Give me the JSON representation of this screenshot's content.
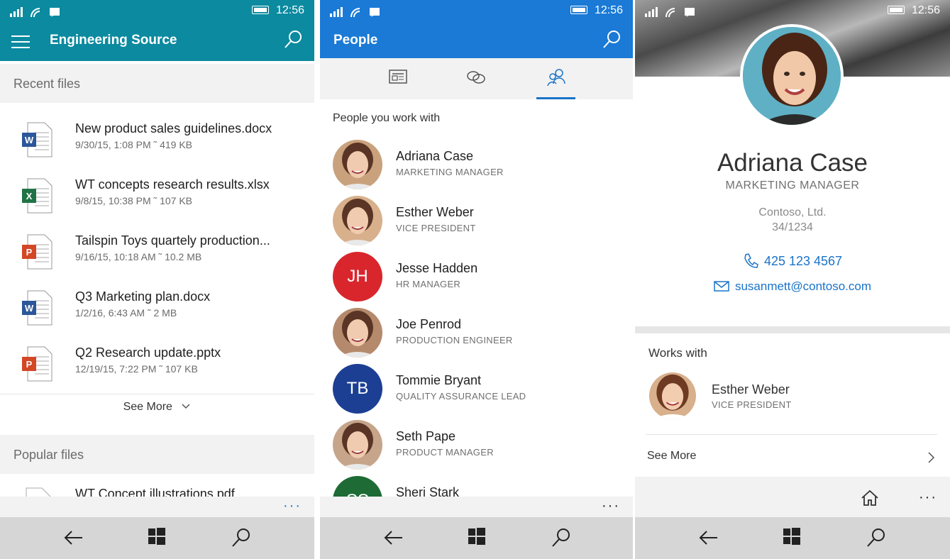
{
  "colors": {
    "teal": "#0b8aa0",
    "blue": "#1a7ad6",
    "word": "#2b579a",
    "excel": "#217346",
    "ppt": "#d24726",
    "jh": "#d9262d",
    "tb": "#1c3f94",
    "ss": "#1e6b35"
  },
  "status": {
    "time": "12:56"
  },
  "left": {
    "title": "Engineering Source",
    "recent_header": "Recent files",
    "files": [
      {
        "icon": "word-doc-icon",
        "type": "word",
        "name": "New product sales guidelines.docx",
        "meta": "9/30/15, 1:08 PM ˜ 419 KB"
      },
      {
        "icon": "excel-doc-icon",
        "type": "excel",
        "name": "WT concepts research results.xlsx",
        "meta": "9/8/15, 10:38 PM ˜ 107 KB"
      },
      {
        "icon": "powerpoint-doc-icon",
        "type": "ppt",
        "name": "Tailspin Toys quartely production...",
        "meta": "9/16/15, 10:18 AM ˜ 10.2 MB"
      },
      {
        "icon": "word-doc-icon",
        "type": "word",
        "name": "Q3 Marketing plan.docx",
        "meta": "1/2/16, 6:43 AM ˜ 2 MB"
      },
      {
        "icon": "powerpoint-doc-icon",
        "type": "ppt",
        "name": "Q2 Research update.pptx",
        "meta": "12/19/15, 7:22 PM ˜ 107 KB"
      }
    ],
    "see_more": "See More",
    "popular_header": "Popular files",
    "popular_files": [
      {
        "icon": "pdf-doc-icon",
        "name": "WT Concept illustrations.pdf"
      }
    ]
  },
  "middle": {
    "title": "People",
    "tabs": [
      {
        "icon": "news-feed-icon"
      },
      {
        "icon": "link-icon"
      },
      {
        "icon": "people-icon"
      }
    ],
    "section": "People you work with",
    "people": [
      {
        "name": "Adriana Case",
        "role": "MARKETING MANAGER",
        "avatar": "photo",
        "color": "#c9a27d"
      },
      {
        "name": "Esther Weber",
        "role": "VICE PRESIDENT",
        "avatar": "photo",
        "color": "#d8b08c"
      },
      {
        "name": "Jesse Hadden",
        "role": "HR MANAGER",
        "avatar": "initials",
        "initials": "JH",
        "color": "#d9262d"
      },
      {
        "name": "Joe Penrod",
        "role": "PRODUCTION ENGINEER",
        "avatar": "photo",
        "color": "#b58a6c"
      },
      {
        "name": "Tommie Bryant",
        "role": "QUALITY ASSURANCE LEAD",
        "avatar": "initials",
        "initials": "TB",
        "color": "#1c3f94"
      },
      {
        "name": "Seth Pape",
        "role": "PRODUCT MANAGER",
        "avatar": "photo",
        "color": "#c6a58b"
      },
      {
        "name": "Sheri Stark",
        "role": "",
        "avatar": "initials",
        "initials": "SS",
        "color": "#1e6b35"
      }
    ]
  },
  "right": {
    "name": "Adriana Case",
    "role": "MARKETING MANAGER",
    "company": "Contoso, Ltd.",
    "office": "34/1234",
    "phone": "425 123 4567",
    "email": "susanmett@contoso.com",
    "works_with_header": "Works with",
    "coworker": {
      "name": "Esther Weber",
      "role": "VICE PRESIDENT"
    },
    "see_more": "See More"
  }
}
